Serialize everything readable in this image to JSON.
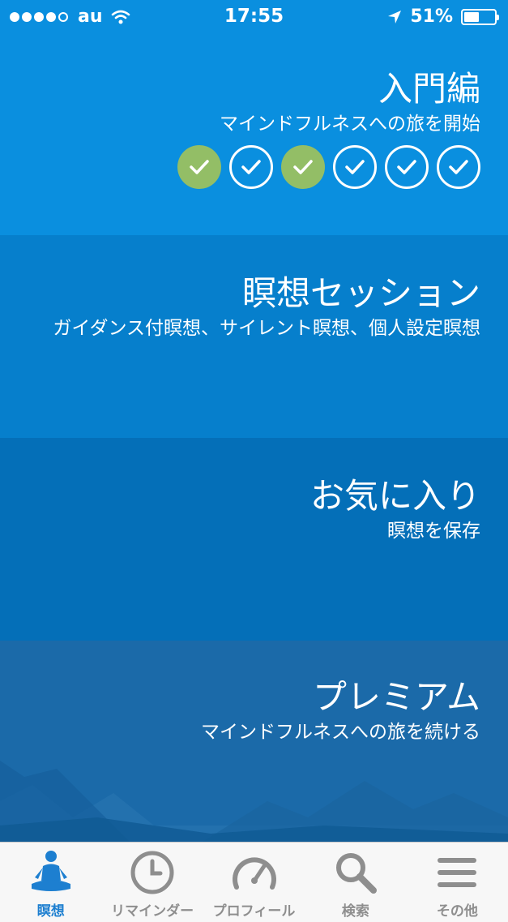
{
  "status_bar": {
    "carrier": "au",
    "time": "17:55",
    "battery_text": "51%",
    "battery_level": 0.51,
    "signal_bars": 4
  },
  "sections": [
    {
      "id": "intro",
      "title": "入門編",
      "subtitle": "マインドフルネスへの旅を開始",
      "progress_steps": [
        "done",
        "todo",
        "done",
        "todo",
        "todo",
        "todo"
      ]
    },
    {
      "id": "sessions",
      "title": "瞑想セッション",
      "subtitle": "ガイダンス付瞑想、サイレント瞑想、個人設定瞑想"
    },
    {
      "id": "favorites",
      "title": "お気に入り",
      "subtitle": "瞑想を保存"
    },
    {
      "id": "premium",
      "title": "プレミアム",
      "subtitle": "マインドフルネスへの旅を続ける"
    }
  ],
  "tabbar": {
    "items": [
      {
        "label": "瞑想",
        "icon": "meditation-icon",
        "active": true
      },
      {
        "label": "リマインダー",
        "icon": "clock-icon",
        "active": false
      },
      {
        "label": "プロフィール",
        "icon": "gauge-icon",
        "active": false
      },
      {
        "label": "検索",
        "icon": "search-icon",
        "active": false
      },
      {
        "label": "その他",
        "icon": "menu-icon",
        "active": false
      }
    ]
  },
  "colors": {
    "section_1": "#0a8fdf",
    "section_2": "#067fcc",
    "section_3": "#046fb8",
    "section_4": "#1b6aa9",
    "progress_done": "#93be66",
    "tab_active": "#1d7fd0",
    "tab_inactive": "#8e8e8e"
  }
}
